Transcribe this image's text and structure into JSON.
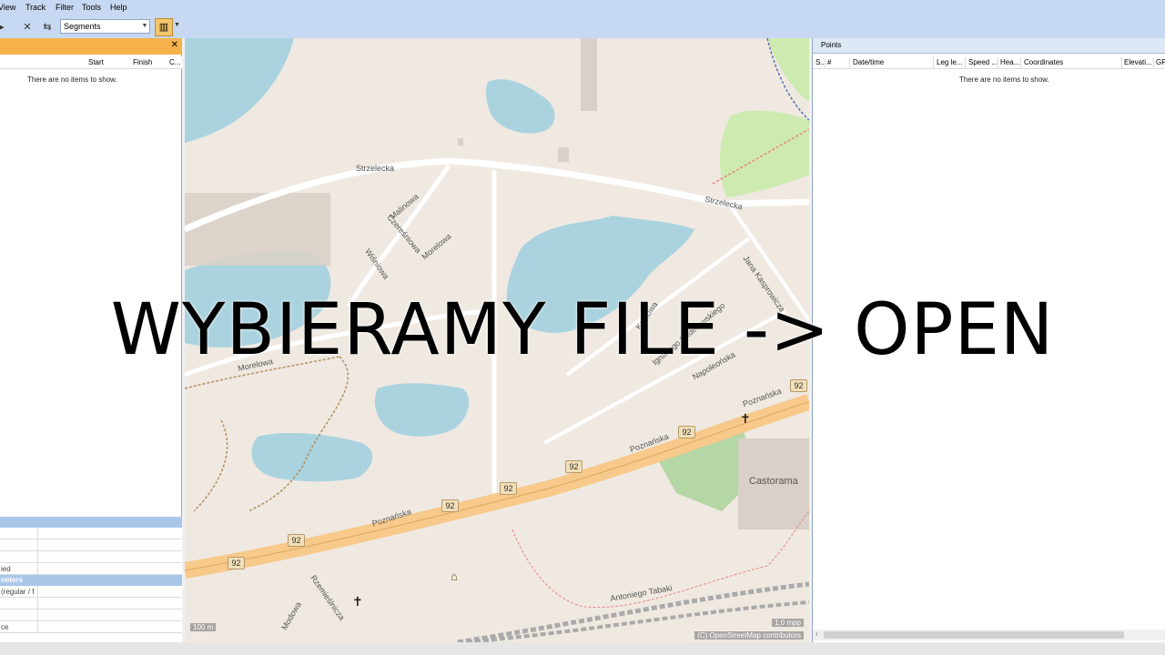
{
  "menu": {
    "view": "View",
    "track": "Track",
    "filter": "Filter",
    "tools": "Tools",
    "help": "Help"
  },
  "toolbar": {
    "segments_value": "Segments"
  },
  "left_panel": {
    "columns": {
      "start": "Start",
      "finish": "Finish",
      "c": "C..."
    },
    "empty_message": "There are no items to show.",
    "props": {
      "row_modified": "ied",
      "section_parameters": "neters",
      "row_regular": "(regular / f",
      "row_distance": "ce"
    }
  },
  "map": {
    "streets": {
      "strzelecka_1": "Strzelecka",
      "strzelecka_2": "Strzelecka",
      "malinowa": "Malinowa",
      "czeresniowa": "Czereśniowa",
      "morelowa_1": "Morelowa",
      "wisniowa": "Wiśniowa",
      "morelowa_2": "Morelowa",
      "jana_kasprowicza": "Jana Kasprowicza",
      "krakowa": "Krakowa",
      "ignacego": "Ignacego Paderewskiego",
      "napoleonska": "Napoleońska",
      "poznanska_1": "Poznańska",
      "poznanska_2": "Poznańska",
      "poznanska_3": "Poznańska",
      "rzemieslnicza": "Rzemieślnicza",
      "modowa": "Modowa",
      "antoniego": "Antoniego Tabaki",
      "castorama": "Castorama"
    },
    "road_number": "92",
    "scale": "100 m",
    "mpp": "1,0 mpp",
    "credit": "(C) OpenStreetMap contributors"
  },
  "right_panel": {
    "title": "Points",
    "columns": {
      "s": "S...",
      "num": "#",
      "datetime": "Date/time",
      "leg": "Leg le...",
      "speed": "Speed ...",
      "heading": "Hea...",
      "coords": "Coordinates",
      "elev": "Elevati...",
      "gp": "GP"
    },
    "empty_message": "There are no items to show."
  },
  "overlay_text": "WYBIERAMY FILE -> OPEN",
  "colors": {
    "toolbar_bg": "#c7d9f2",
    "panel_header_orange": "#f6b24a",
    "water": "#aad3df",
    "road_major": "#f7c98b"
  }
}
